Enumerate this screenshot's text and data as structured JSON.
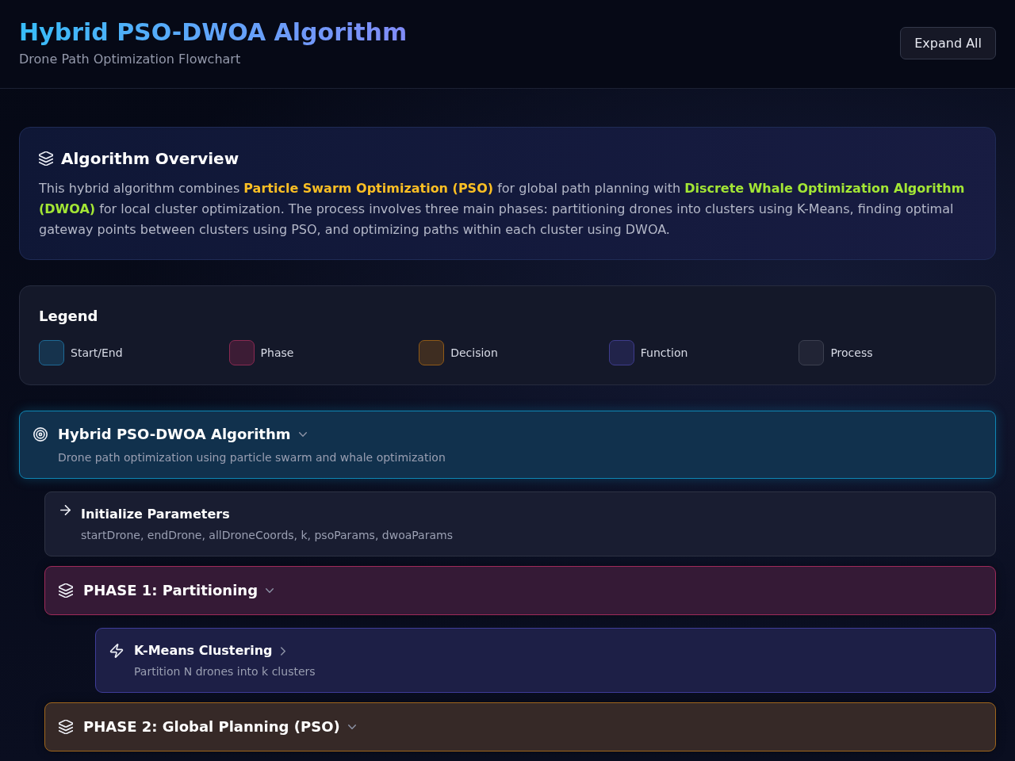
{
  "header": {
    "title": "Hybrid PSO-DWOA Algorithm",
    "subtitle": "Drone Path Optimization Flowchart",
    "button": "Expand All"
  },
  "overview": {
    "title": "Algorithm Overview",
    "segments": [
      {
        "text": "This hybrid algorithm combines "
      },
      {
        "text": "Particle Swarm Optimization (PSO)",
        "color": "#fbbf24"
      },
      {
        "text": " for global path planning with "
      },
      {
        "text": "Discrete Whale Optimization Algorithm (DWOA)",
        "color": "#a3e635"
      },
      {
        "text": " for local cluster optimization. The process involves three main phases: partitioning drones into clusters using K-Means, finding optimal gateway points between clusters using PSO, and optimizing paths within each cluster using DWOA."
      }
    ]
  },
  "legend": {
    "title": "Legend",
    "items": [
      {
        "label": "Start/End",
        "color": "#1e6a96"
      },
      {
        "label": "Phase",
        "color": "#8a2a52"
      },
      {
        "label": "Decision",
        "color": "#8f5a18"
      },
      {
        "label": "Function",
        "color": "#3e3c8c"
      },
      {
        "label": "Process",
        "color": "#3c4050"
      }
    ]
  },
  "flowchart": {
    "nodes": [
      {
        "kind": "start",
        "color": "#0e86b4",
        "title": "Hybrid PSO-DWOA Algorithm",
        "expanded": true,
        "description": "Drone path optimization using particle swarm and whale optimization",
        "children": [
          {
            "kind": "process",
            "color": "#2e3344",
            "title": "Initialize Parameters",
            "description": "startDrone, endDrone, allDroneCoords, k, psoParams, dwoaParams"
          },
          {
            "kind": "phase",
            "color": "#9f2a5a",
            "title": "PHASE 1: Partitioning",
            "expanded": true,
            "children": [
              {
                "kind": "function",
                "color": "#3f3d99",
                "title": "K-Means Clustering",
                "expanded": false,
                "description": "Partition N drones into k clusters"
              }
            ]
          },
          {
            "kind": "phase",
            "color": "#a0661c",
            "title": "PHASE 2: Global Planning (PSO)",
            "expanded": true
          }
        ]
      }
    ]
  }
}
